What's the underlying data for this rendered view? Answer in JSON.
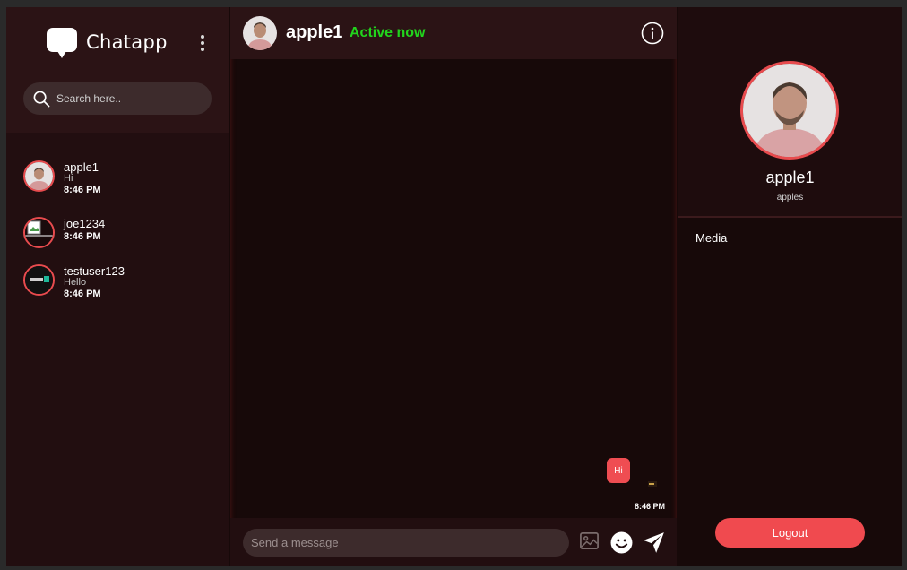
{
  "app": {
    "brand": "Chatapp"
  },
  "sidebar": {
    "search_placeholder": "Search here..",
    "chats": [
      {
        "name": "apple1",
        "last_message": "Hi",
        "time": "8:46 PM"
      },
      {
        "name": "joe1234",
        "last_message": "",
        "time": "8:46 PM"
      },
      {
        "name": "testuser123",
        "last_message": "Hello",
        "time": "8:46 PM"
      }
    ]
  },
  "chat": {
    "contact_name": "apple1",
    "status": "Active now",
    "messages": [
      {
        "text": "Hi",
        "time": "8:46 PM",
        "from": "me"
      }
    ],
    "composer_placeholder": "Send a message"
  },
  "panel": {
    "name": "apple1",
    "subtitle": "apples",
    "media_label": "Media",
    "logout_label": "Logout"
  },
  "colors": {
    "accent": "#ef4d52",
    "status": "#22d41d",
    "bg": "#170909"
  }
}
